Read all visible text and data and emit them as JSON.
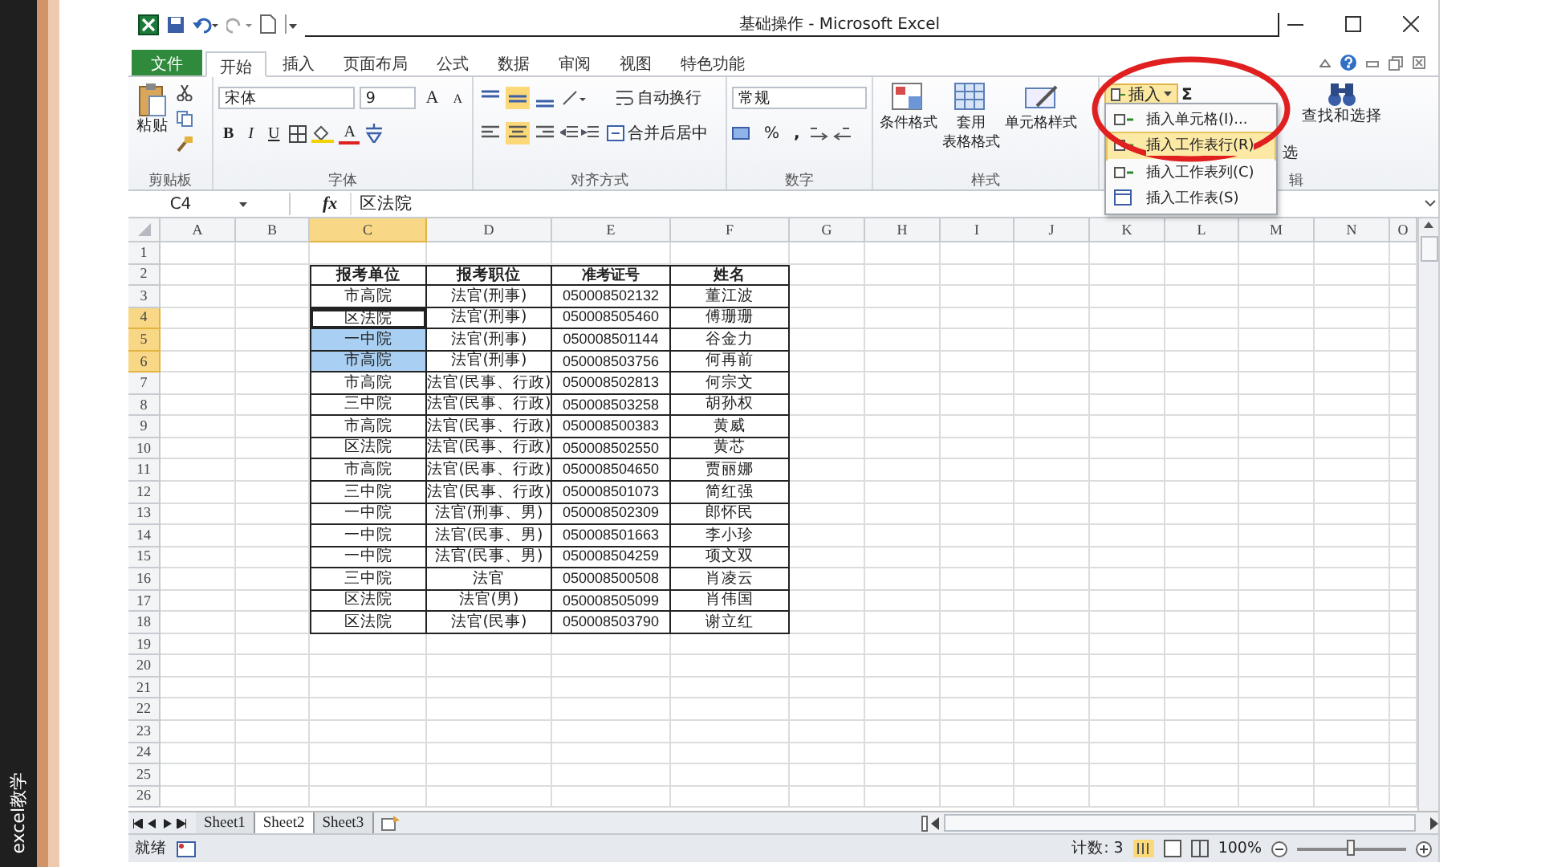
{
  "side_caption": "excel教学",
  "window": {
    "title": "基础操作 - Microsoft Excel"
  },
  "tabs": [
    {
      "label": "文件",
      "kind": "file",
      "selected": false
    },
    {
      "label": "开始",
      "kind": "tab",
      "selected": true
    },
    {
      "label": "插入",
      "kind": "tab",
      "selected": false
    },
    {
      "label": "页面布局",
      "kind": "tab",
      "selected": false
    },
    {
      "label": "公式",
      "kind": "tab",
      "selected": false
    },
    {
      "label": "数据",
      "kind": "tab",
      "selected": false
    },
    {
      "label": "审阅",
      "kind": "tab",
      "selected": false
    },
    {
      "label": "视图",
      "kind": "tab",
      "selected": false
    },
    {
      "label": "特色功能",
      "kind": "tab",
      "selected": false
    }
  ],
  "ribbon": {
    "clipboard": {
      "paste": "粘贴",
      "label": "剪贴板"
    },
    "font": {
      "name": "宋体",
      "size": "9",
      "grow": "A",
      "shrink": "A",
      "bold": "B",
      "italic": "I",
      "underline": "U",
      "font_color_label": "A",
      "label": "字体"
    },
    "alignment": {
      "vertical": [
        {
          "selected": false
        },
        {
          "selected": true
        },
        {
          "selected": false
        }
      ],
      "horizontal": [
        {
          "selected": false
        },
        {
          "selected": true
        },
        {
          "selected": false
        }
      ],
      "wrap": "自动换行",
      "merge": "合并后居中",
      "label": "对齐方式"
    },
    "number": {
      "format": "常规",
      "percent": "%",
      "comma": ",",
      "label": "数字"
    },
    "styles": {
      "buttons": [
        {
          "lines": [
            "条件格式"
          ]
        },
        {
          "lines": [
            "套用",
            "表格格式"
          ]
        },
        {
          "lines": [
            "单元格样式"
          ]
        }
      ],
      "label": "样式"
    },
    "cells": {
      "insert": "插入",
      "expanded": true
    },
    "editing": {
      "sum": "Σ",
      "sort_partial": "选",
      "find": "查找和选择",
      "label_partial": "辑"
    }
  },
  "insert_menu": [
    {
      "label": "插入单元格(I)...",
      "selected": false
    },
    {
      "label": "插入工作表行(R)",
      "selected": true
    },
    {
      "label": "插入工作表列(C)",
      "selected": false
    },
    {
      "label": "插入工作表(S)",
      "selected": false
    }
  ],
  "formula_bar": {
    "name_box": "C4",
    "fx": "fx",
    "value": "区法院"
  },
  "sheet": {
    "columns": [
      {
        "label": "A",
        "selected": false
      },
      {
        "label": "B",
        "selected": false
      },
      {
        "label": "C",
        "selected": true
      },
      {
        "label": "D",
        "selected": false
      },
      {
        "label": "E",
        "selected": false
      },
      {
        "label": "F",
        "selected": false
      },
      {
        "label": "G",
        "selected": false
      },
      {
        "label": "H",
        "selected": false
      },
      {
        "label": "I",
        "selected": false
      },
      {
        "label": "J",
        "selected": false
      },
      {
        "label": "K",
        "selected": false
      },
      {
        "label": "L",
        "selected": false
      },
      {
        "label": "M",
        "selected": false
      },
      {
        "label": "N",
        "selected": false
      },
      {
        "label": "O",
        "selected": false
      }
    ],
    "rows": [
      {
        "label": "1",
        "selected": false,
        "kind": "empty"
      },
      {
        "label": "2",
        "selected": false,
        "kind": "heading",
        "cells": [
          {
            "text": "报考单位",
            "selected": false,
            "active": false
          },
          {
            "text": "报考职位",
            "selected": false,
            "active": false
          },
          {
            "text": "准考证号",
            "selected": false,
            "active": false
          },
          {
            "text": "姓名",
            "selected": false,
            "active": false
          }
        ]
      },
      {
        "label": "3",
        "selected": false,
        "kind": "data",
        "cells": [
          {
            "text": "市高院",
            "selected": false,
            "active": false
          },
          {
            "text": "法官(刑事)",
            "selected": false,
            "active": false
          },
          {
            "text": "050008502132",
            "selected": false,
            "active": false
          },
          {
            "text": "董江波",
            "selected": false,
            "active": false
          }
        ]
      },
      {
        "label": "4",
        "selected": true,
        "kind": "data",
        "cells": [
          {
            "text": "区法院",
            "selected": true,
            "active": true
          },
          {
            "text": "法官(刑事)",
            "selected": false,
            "active": false
          },
          {
            "text": "050008505460",
            "selected": false,
            "active": false
          },
          {
            "text": "傅珊珊",
            "selected": false,
            "active": false
          }
        ]
      },
      {
        "label": "5",
        "selected": true,
        "kind": "data",
        "cells": [
          {
            "text": "一中院",
            "selected": true,
            "active": false
          },
          {
            "text": "法官(刑事)",
            "selected": false,
            "active": false
          },
          {
            "text": "050008501144",
            "selected": false,
            "active": false
          },
          {
            "text": "谷金力",
            "selected": false,
            "active": false
          }
        ]
      },
      {
        "label": "6",
        "selected": true,
        "kind": "data",
        "cells": [
          {
            "text": "市高院",
            "selected": true,
            "active": false
          },
          {
            "text": "法官(刑事)",
            "selected": false,
            "active": false
          },
          {
            "text": "050008503756",
            "selected": false,
            "active": false
          },
          {
            "text": "何再前",
            "selected": false,
            "active": false
          }
        ]
      },
      {
        "label": "7",
        "selected": false,
        "kind": "data",
        "cells": [
          {
            "text": "市高院",
            "selected": false,
            "active": false
          },
          {
            "text": "法官(民事、行政)",
            "selected": false,
            "active": false
          },
          {
            "text": "050008502813",
            "selected": false,
            "active": false
          },
          {
            "text": "何宗文",
            "selected": false,
            "active": false
          }
        ]
      },
      {
        "label": "8",
        "selected": false,
        "kind": "data",
        "cells": [
          {
            "text": "三中院",
            "selected": false,
            "active": false
          },
          {
            "text": "法官(民事、行政)",
            "selected": false,
            "active": false
          },
          {
            "text": "050008503258",
            "selected": false,
            "active": false
          },
          {
            "text": "胡孙权",
            "selected": false,
            "active": false
          }
        ]
      },
      {
        "label": "9",
        "selected": false,
        "kind": "data",
        "cells": [
          {
            "text": "市高院",
            "selected": false,
            "active": false
          },
          {
            "text": "法官(民事、行政)",
            "selected": false,
            "active": false
          },
          {
            "text": "050008500383",
            "selected": false,
            "active": false
          },
          {
            "text": "黄威",
            "selected": false,
            "active": false
          }
        ]
      },
      {
        "label": "10",
        "selected": false,
        "kind": "data",
        "cells": [
          {
            "text": "区法院",
            "selected": false,
            "active": false
          },
          {
            "text": "法官(民事、行政)",
            "selected": false,
            "active": false
          },
          {
            "text": "050008502550",
            "selected": false,
            "active": false
          },
          {
            "text": "黄芯",
            "selected": false,
            "active": false
          }
        ]
      },
      {
        "label": "11",
        "selected": false,
        "kind": "data",
        "cells": [
          {
            "text": "市高院",
            "selected": false,
            "active": false
          },
          {
            "text": "法官(民事、行政)",
            "selected": false,
            "active": false
          },
          {
            "text": "050008504650",
            "selected": false,
            "active": false
          },
          {
            "text": "贾丽娜",
            "selected": false,
            "active": false
          }
        ]
      },
      {
        "label": "12",
        "selected": false,
        "kind": "data",
        "cells": [
          {
            "text": "三中院",
            "selected": false,
            "active": false
          },
          {
            "text": "法官(民事、行政)",
            "selected": false,
            "active": false
          },
          {
            "text": "050008501073",
            "selected": false,
            "active": false
          },
          {
            "text": "简红强",
            "selected": false,
            "active": false
          }
        ]
      },
      {
        "label": "13",
        "selected": false,
        "kind": "data",
        "cells": [
          {
            "text": "一中院",
            "selected": false,
            "active": false
          },
          {
            "text": "法官(刑事、男)",
            "selected": false,
            "active": false
          },
          {
            "text": "050008502309",
            "selected": false,
            "active": false
          },
          {
            "text": "郎怀民",
            "selected": false,
            "active": false
          }
        ]
      },
      {
        "label": "14",
        "selected": false,
        "kind": "data",
        "cells": [
          {
            "text": "一中院",
            "selected": false,
            "active": false
          },
          {
            "text": "法官(民事、男)",
            "selected": false,
            "active": false
          },
          {
            "text": "050008501663",
            "selected": false,
            "active": false
          },
          {
            "text": "李小珍",
            "selected": false,
            "active": false
          }
        ]
      },
      {
        "label": "15",
        "selected": false,
        "kind": "data",
        "cells": [
          {
            "text": "一中院",
            "selected": false,
            "active": false
          },
          {
            "text": "法官(民事、男)",
            "selected": false,
            "active": false
          },
          {
            "text": "050008504259",
            "selected": false,
            "active": false
          },
          {
            "text": "项文双",
            "selected": false,
            "active": false
          }
        ]
      },
      {
        "label": "16",
        "selected": false,
        "kind": "data",
        "cells": [
          {
            "text": "三中院",
            "selected": false,
            "active": false
          },
          {
            "text": "法官",
            "selected": false,
            "active": false
          },
          {
            "text": "050008500508",
            "selected": false,
            "active": false
          },
          {
            "text": "肖凌云",
            "selected": false,
            "active": false
          }
        ]
      },
      {
        "label": "17",
        "selected": false,
        "kind": "data",
        "cells": [
          {
            "text": "区法院",
            "selected": false,
            "active": false
          },
          {
            "text": "法官(男)",
            "selected": false,
            "active": false
          },
          {
            "text": "050008505099",
            "selected": false,
            "active": false
          },
          {
            "text": "肖伟国",
            "selected": false,
            "active": false
          }
        ]
      },
      {
        "label": "18",
        "selected": false,
        "kind": "data",
        "cells": [
          {
            "text": "区法院",
            "selected": false,
            "active": false
          },
          {
            "text": "法官(民事)",
            "selected": false,
            "active": false
          },
          {
            "text": "050008503790",
            "selected": false,
            "active": false
          },
          {
            "text": "谢立红",
            "selected": false,
            "active": false
          }
        ]
      },
      {
        "label": "19",
        "selected": false,
        "kind": "empty"
      },
      {
        "label": "20",
        "selected": false,
        "kind": "empty"
      },
      {
        "label": "21",
        "selected": false,
        "kind": "empty"
      },
      {
        "label": "22",
        "selected": false,
        "kind": "empty"
      },
      {
        "label": "23",
        "selected": false,
        "kind": "empty"
      },
      {
        "label": "24",
        "selected": false,
        "kind": "empty"
      },
      {
        "label": "25",
        "selected": false,
        "kind": "empty"
      },
      {
        "label": "26",
        "selected": false,
        "kind": "empty"
      }
    ]
  },
  "sheet_tabs": [
    {
      "label": "Sheet1",
      "selected": false
    },
    {
      "label": "Sheet2",
      "selected": true
    },
    {
      "label": "Sheet3",
      "selected": false
    }
  ],
  "status_bar": {
    "ready": "就绪",
    "count": "计数: 3",
    "zoom": "100%",
    "zoom_slider": {
      "level": 0.5
    }
  }
}
